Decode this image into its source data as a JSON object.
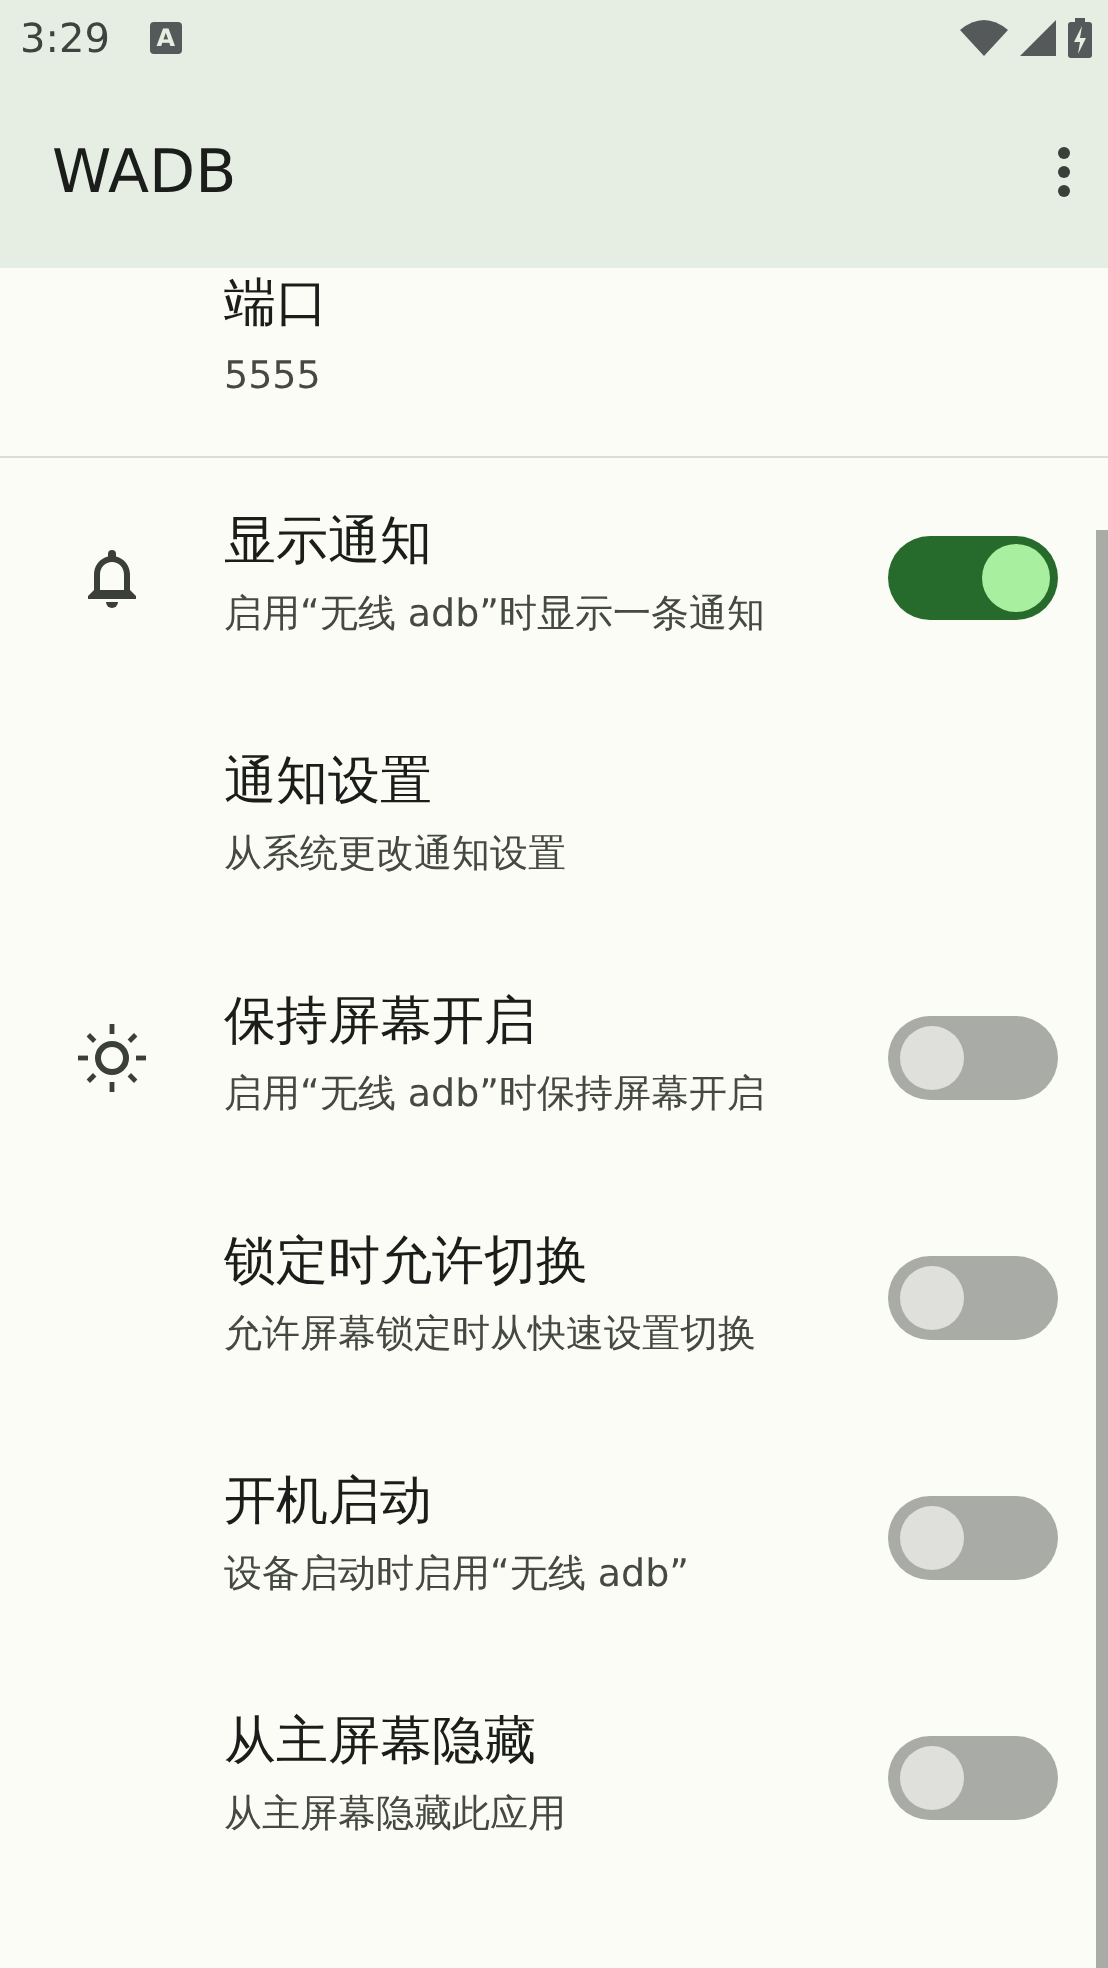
{
  "status_bar": {
    "time": "3:29",
    "notification_icon": "A"
  },
  "app_bar": {
    "title": "WADB"
  },
  "port": {
    "title": "端口",
    "value": "5555"
  },
  "settings": [
    {
      "kind": "switch",
      "title": "显示通知",
      "summary": "启用“无线 adb”时显示一条通知",
      "on": true
    },
    {
      "kind": "link",
      "title": "通知设置",
      "summary": "从系统更改通知设置"
    },
    {
      "kind": "switch",
      "title": "保持屏幕开启",
      "summary": "启用“无线 adb”时保持屏幕开启",
      "on": false
    },
    {
      "kind": "switch",
      "title": "锁定时允许切换",
      "summary": "允许屏幕锁定时从快速设置切换",
      "on": false
    },
    {
      "kind": "switch",
      "title": "开机启动",
      "summary": "设备启动时启用“无线 adb”",
      "on": false
    },
    {
      "kind": "switch",
      "title": "从主屏幕隐藏",
      "summary": "从主屏幕隐藏此应用",
      "on": false
    }
  ]
}
